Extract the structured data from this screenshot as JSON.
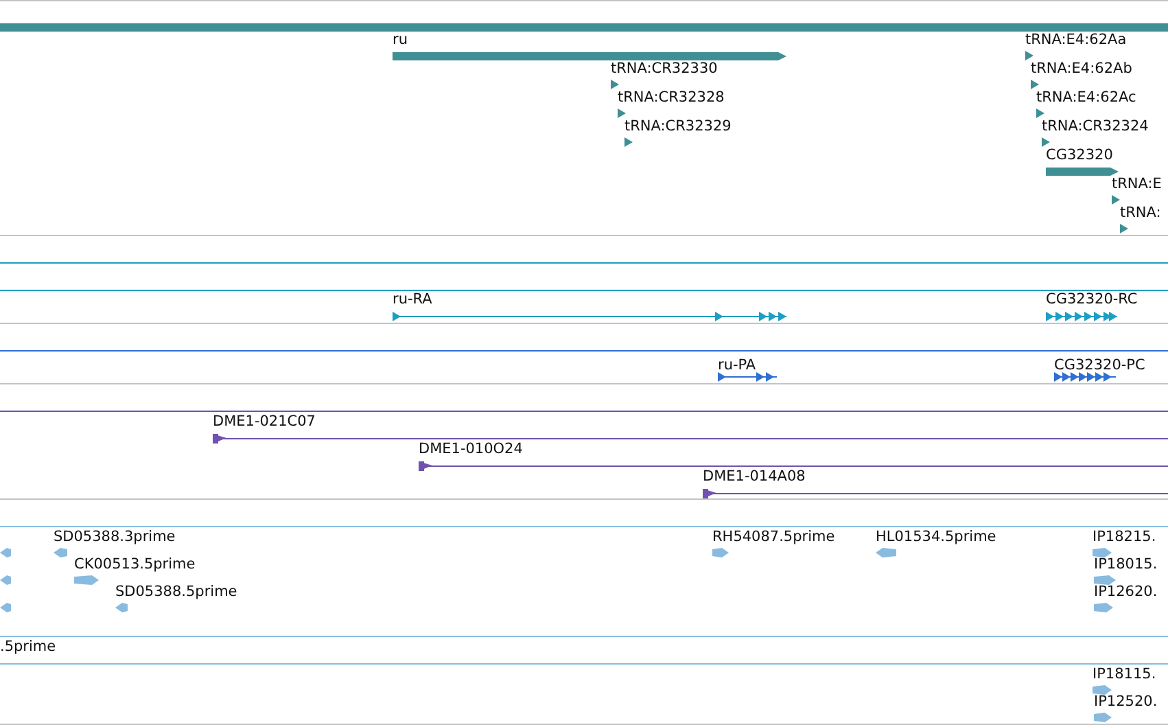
{
  "tracks": [
    {
      "kind": "gene",
      "color": "#3f8f94",
      "features": [
        {
          "kind": "span"
        },
        {
          "kind": "bar",
          "label": "ru",
          "reverse": false
        },
        {
          "kind": "tick",
          "label": "tRNA:E4:62Aa",
          "reverse": false
        },
        {
          "kind": "tick",
          "label": "tRNA:CR32330",
          "reverse": false
        },
        {
          "kind": "tick",
          "label": "tRNA:E4:62Ab",
          "reverse": false
        },
        {
          "kind": "tick",
          "label": "tRNA:CR32328",
          "reverse": false
        },
        {
          "kind": "tick",
          "label": "tRNA:E4:62Ac",
          "reverse": false
        },
        {
          "kind": "tick",
          "label": "tRNA:CR32329",
          "reverse": false
        },
        {
          "kind": "tick",
          "label": "tRNA:CR32324",
          "reverse": false
        },
        {
          "kind": "bar",
          "label": "CG32320",
          "reverse": false
        },
        {
          "kind": "tick",
          "label": "tRNA:E",
          "reverse": false
        },
        {
          "kind": "tick",
          "label": "tRNA:",
          "reverse": false
        }
      ]
    },
    {
      "kind": "transcript",
      "color": "#1ba0c4",
      "features": [
        {
          "kind": "span"
        },
        {
          "kind": "span"
        },
        {
          "kind": "exons",
          "label": "ru-RA",
          "reverse": false
        },
        {
          "kind": "exons",
          "label": "CG32320-RC",
          "reverse": false
        }
      ]
    },
    {
      "kind": "transcript",
      "color": "#2f6fd2",
      "features": [
        {
          "kind": "span"
        },
        {
          "kind": "exons",
          "label": "ru-PA",
          "reverse": false
        },
        {
          "kind": "exons",
          "label": "CG32320-PC",
          "reverse": false
        }
      ]
    },
    {
      "kind": "clone",
      "color": "#7152b0",
      "features": [
        {
          "kind": "span"
        },
        {
          "kind": "line",
          "label": "DME1-021C07",
          "reverse": false
        },
        {
          "kind": "line",
          "label": "DME1-010O24",
          "reverse": false
        },
        {
          "kind": "line",
          "label": "DME1-014A08",
          "reverse": false
        }
      ]
    },
    {
      "kind": "est",
      "color": "#88bbdf",
      "features": [
        {
          "kind": "span"
        },
        {
          "kind": "read",
          "reverse": true
        },
        {
          "kind": "read",
          "label": "SD05388.3prime",
          "reverse": true
        },
        {
          "kind": "read",
          "label": "RH54087.5prime",
          "reverse": false
        },
        {
          "kind": "read",
          "label": "HL01534.5prime",
          "reverse": true
        },
        {
          "kind": "read",
          "label": "IP18215.",
          "reverse": false
        },
        {
          "kind": "read",
          "reverse": true
        },
        {
          "kind": "read",
          "label": "CK00513.5prime",
          "reverse": false
        },
        {
          "kind": "read",
          "label": "IP18015.",
          "reverse": false
        },
        {
          "kind": "read",
          "reverse": true
        },
        {
          "kind": "read",
          "label": "SD05388.5prime",
          "reverse": true
        },
        {
          "kind": "read",
          "label": "IP12620.",
          "reverse": false
        },
        {
          "kind": "span"
        },
        {
          "kind": "span",
          "label": ".5prime"
        },
        {
          "kind": "read",
          "label": "IP18115.",
          "reverse": false
        },
        {
          "kind": "read",
          "label": "IP12520.",
          "reverse": false
        }
      ]
    }
  ]
}
